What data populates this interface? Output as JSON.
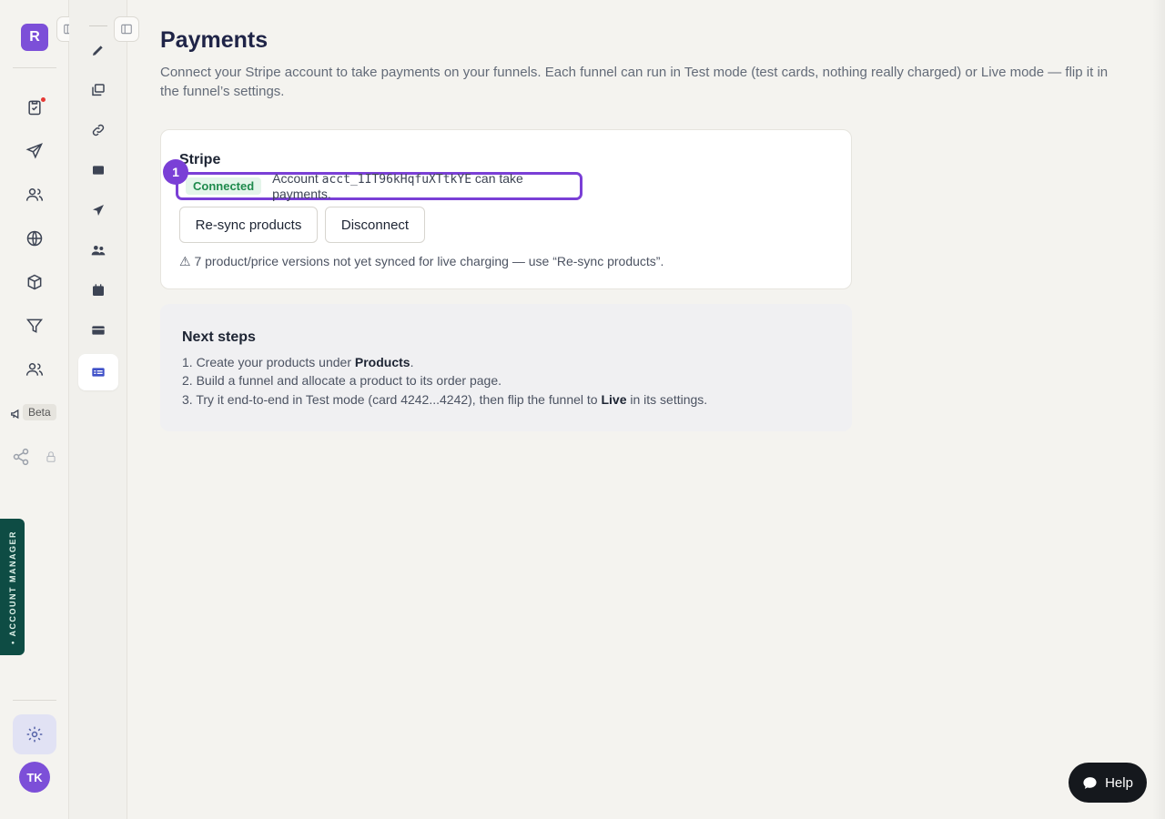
{
  "rail": {
    "logo_letter": "R",
    "beta_label": "Beta",
    "account_manager_label": "• ACCOUNT MANAGER",
    "avatar_initials": "TK",
    "icons": [
      "clipboard-check-icon",
      "send-icon",
      "users-icon",
      "globe-icon",
      "box-icon",
      "filter-icon",
      "team-icon",
      "megaphone-icon",
      "share-icon",
      "lock-icon",
      "gear-icon"
    ]
  },
  "subnav": {
    "icons": [
      "pen-icon",
      "gallery-icon",
      "link-icon",
      "mail-icon",
      "paper-plane-icon",
      "group-icon",
      "calendar-icon",
      "card-icon",
      "payments-icon"
    ],
    "active": "payments-icon"
  },
  "page": {
    "title": "Payments",
    "description": "Connect your Stripe account to take payments on your funnels. Each funnel can run in Test mode (test cards, nothing really charged) or Live mode — flip it in the funnel’s settings."
  },
  "stripe_card": {
    "title": "Stripe",
    "marker": "1",
    "status_badge": "Connected",
    "account_prefix": "Account",
    "account_id": "acct_1IT96kHqfuXTtkYE",
    "account_suffix": "can take payments.",
    "resync_label": "Re-sync products",
    "disconnect_label": "Disconnect",
    "warning": "⚠ 7 product/price versions not yet synced for live charging — use “Re-sync products”."
  },
  "next_steps": {
    "title": "Next steps",
    "step1_prefix": "1. Create your products under ",
    "step1_bold": "Products",
    "step1_suffix": ".",
    "step2": "2. Build a funnel and allocate a product to its order page.",
    "step3_prefix": "3. Try it end-to-end in Test mode (card 4242...4242), then flip the funnel to ",
    "step3_bold": "Live",
    "step3_suffix": " in its settings."
  },
  "help": {
    "label": "Help"
  },
  "colors": {
    "accent": "#7a3fd6",
    "connected": "#1f8a4c",
    "help_bg": "#15181d"
  }
}
